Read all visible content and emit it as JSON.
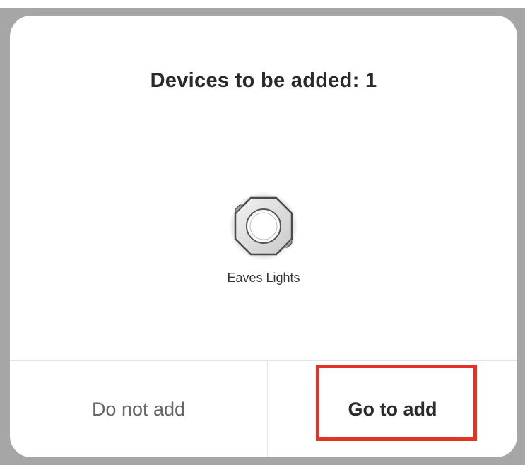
{
  "dialog": {
    "title": "Devices to be added: 1",
    "device": {
      "label": "Eaves Lights",
      "icon": "octagon-light-icon"
    },
    "buttons": {
      "cancel_label": "Do not add",
      "confirm_label": "Go to add"
    }
  },
  "colors": {
    "highlight": "#e53226",
    "backdrop": "#a6a6a6",
    "dialog_bg": "#ffffff"
  }
}
